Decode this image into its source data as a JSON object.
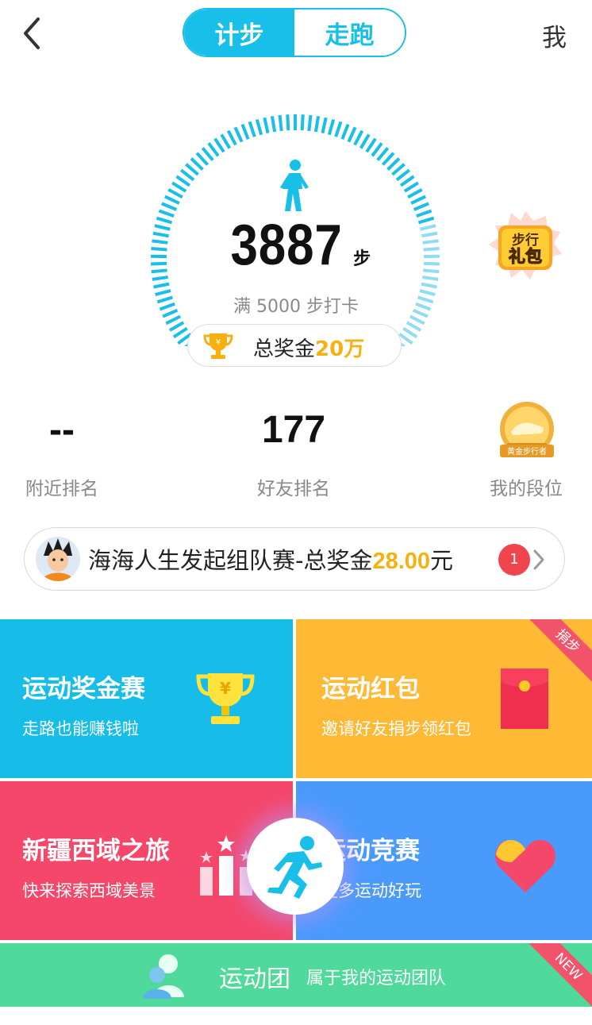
{
  "header": {
    "tabs": [
      {
        "label": "计步",
        "active": true
      },
      {
        "label": "走跑",
        "active": false
      }
    ],
    "profile_label": "我"
  },
  "pedometer": {
    "steps": "3887",
    "unit": "步",
    "goal_text": "满 5000 步打卡",
    "goal_steps": 5000,
    "progress_fraction": 0.7774,
    "prize_label": "总奖金",
    "prize_value": "20万"
  },
  "gift_badge": {
    "line1": "步行",
    "line2": "礼包"
  },
  "stats": {
    "nearby": {
      "value": "--",
      "label": "附近排名"
    },
    "friends": {
      "value": "177",
      "label": "好友排名"
    },
    "rank": {
      "label": "我的段位",
      "medal_text": "黄金步行者"
    }
  },
  "team_bar": {
    "text_prefix": "海海人生发起组队赛-总奖金",
    "amount": "28.00",
    "text_suffix": "元",
    "badge_count": "1"
  },
  "tiles": [
    {
      "title": "运动奖金赛",
      "subtitle": "走路也能赚钱啦",
      "color": "#16bde8",
      "icon": "trophy-icon"
    },
    {
      "title": "运动红包",
      "subtitle": "邀请好友捐步领红包",
      "color": "#ffb935",
      "icon": "red-envelope-icon",
      "ribbon": "捐步"
    },
    {
      "title": "新疆西域之旅",
      "subtitle": "快来探索西域美景",
      "color": "#f5476a",
      "icon": "podium-stars-icon"
    },
    {
      "title": "运动竞赛",
      "subtitle": "更多运动好玩",
      "color": "#4a9afc",
      "icon": "heart-icon"
    }
  ],
  "club": {
    "title": "运动团",
    "subtitle": "属于我的运动团队",
    "ribbon": "NEW",
    "color": "#4fd99b"
  },
  "colors": {
    "accent": "#18bfe8",
    "gold": "#f6b10f",
    "badge_red": "#f0444e"
  }
}
